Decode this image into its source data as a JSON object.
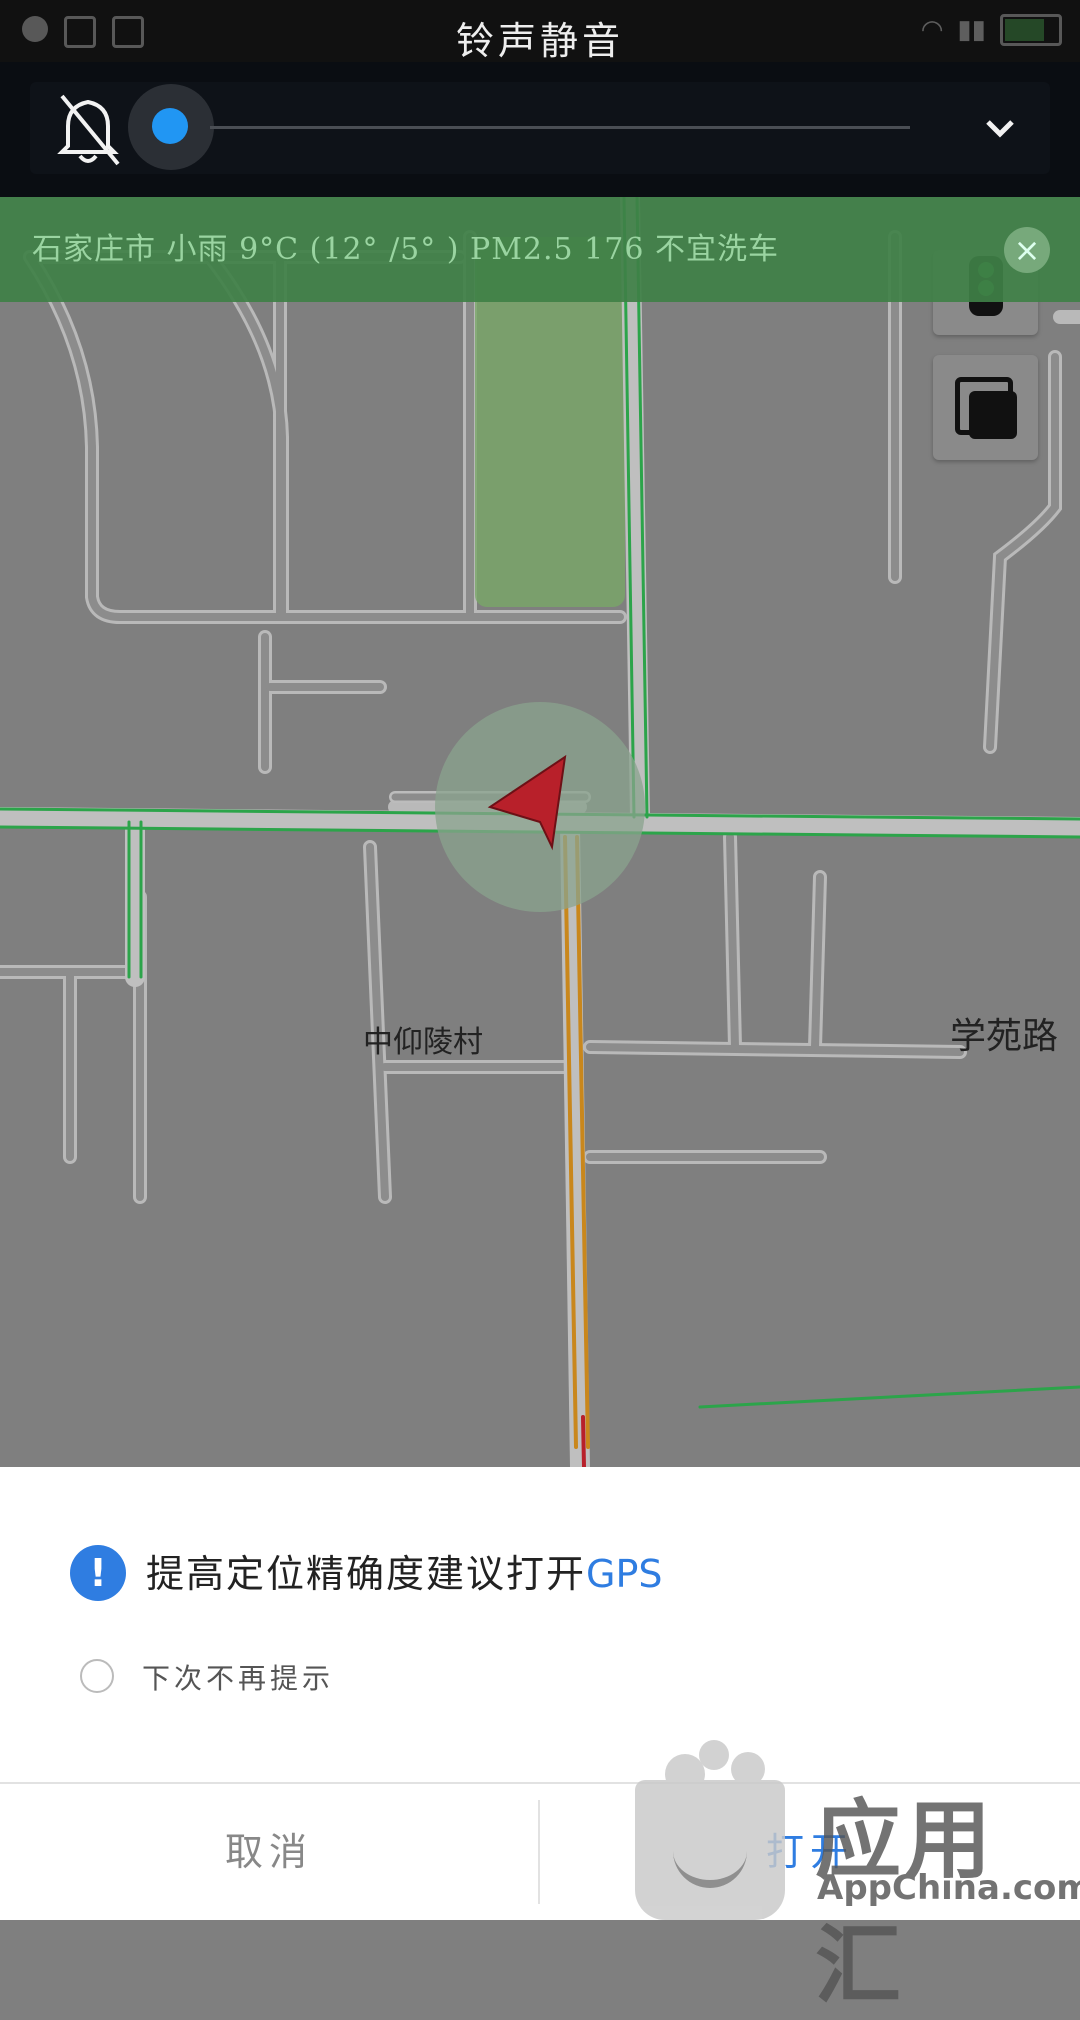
{
  "status_bar": {
    "title": "铃声静音"
  },
  "volume_panel": {
    "level": 0.0
  },
  "weather_banner": {
    "text": "石家庄市 小雨 9°C (12° /5° ) PM2.5 176 不宜洗车",
    "close_symbol": "×"
  },
  "map": {
    "labels": {
      "village": "中仰陵村",
      "road": "学苑路"
    },
    "colors": {
      "background": "#7f7f7f",
      "road": "#9a9a9a",
      "road_edge": "#bcbcbc",
      "traffic_green": "#2ca44a",
      "traffic_orange": "#c9871c",
      "park": "#79a868",
      "location_marker": "#b8202a"
    }
  },
  "dialog": {
    "icon": "!",
    "message": "提高定位精确度建议打开",
    "message_highlight": "GPS",
    "checkbox_label": "下次不再提示",
    "cancel_label": "取消",
    "open_label": "打开",
    "accent_color": "#2f7de1"
  },
  "watermark": {
    "text": "应用汇",
    "subtext": "AppChina.com"
  }
}
